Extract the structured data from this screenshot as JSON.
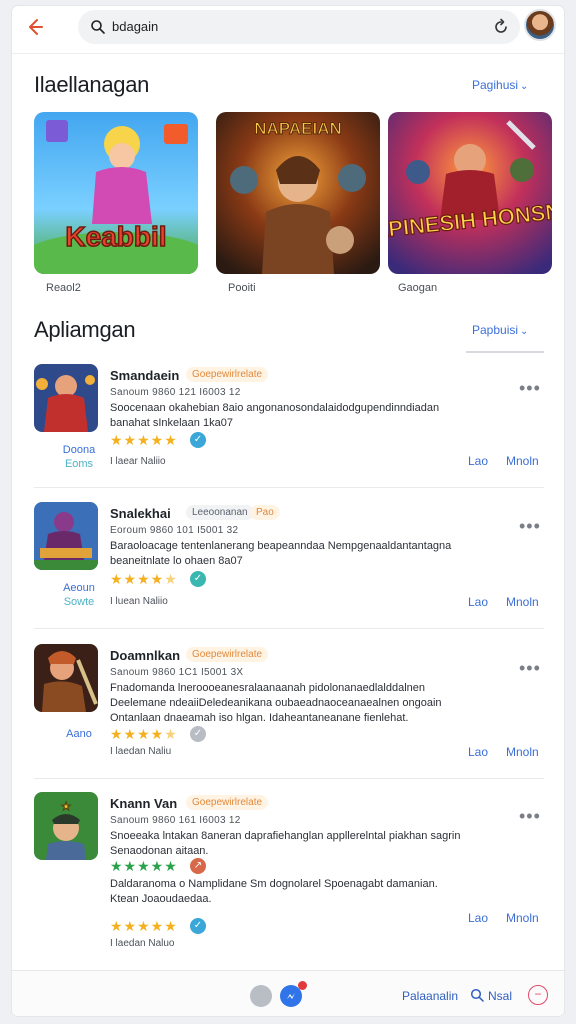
{
  "topbar": {
    "back_icon": "arrow-left-icon",
    "search_value": "bdagain",
    "search_icon": "search-icon",
    "refresh_icon": "refresh-icon",
    "avatar_icon": "user-avatar"
  },
  "featured": {
    "title": "Ilaellanagan",
    "see_all": "Pagihusi",
    "items": [
      {
        "label": "Reaol2",
        "art_text": "Keabbil"
      },
      {
        "label": "Pooiti",
        "art_text": "NAPAEIAN"
      },
      {
        "label": "Gaogan",
        "art_text": "HAPINESIH HONSNIS"
      }
    ]
  },
  "apps": {
    "title": "Apliamgan",
    "see_all": "Papbuisi",
    "items": [
      {
        "name": "Smandaein",
        "badge": "Goepewirlrelate",
        "meta": "Sanoum 9860 121 I6003 12",
        "desc_lines": [
          "Soocenaan okahebian 8aio angonanosondalaidodgupendinndiadan",
          "banahat sInkelaan 1ka07"
        ],
        "rating": 5,
        "rating_badge": "✓",
        "sub": "I laear Naliio",
        "side1": "Doona",
        "side2": "Eoms",
        "act1": "Lao",
        "act2": "Mnoln"
      },
      {
        "name": "Snalekhai",
        "badge": "Leeoonanan",
        "badge2": "Pao",
        "meta": "Eoroum 9860 101 I5001 32",
        "desc_lines": [
          "Baraoloacage tentenlanerang beapeanndaa Nempgenaaldantantagna",
          "beaneitnlate lo ohaen 8a07"
        ],
        "rating": 4,
        "rating_badge": "✓",
        "sub": "I luean Naliio",
        "side1": "Aeoun",
        "side2": "Sowte",
        "act1": "Lao",
        "act2": "Mnoln"
      },
      {
        "name": "Doamnlkan",
        "badge": "Goepewirlrelate",
        "meta": "Sanoum 9860 1C1 I5001 3X",
        "desc_lines": [
          "Fnadomanda lneroooeanesralaanaanah pidolonanaedlalddalnen",
          "Deelemane ndeaiiDeledeanikana oubaeadnaoceanaealnen ongoain",
          "Ontanlaan dnaeamah iso hlgan. Idaheantaneanane fienlehat."
        ],
        "rating": 4,
        "rating_badge": "✓",
        "sub": "I laedan Naliu",
        "side1": "Aano",
        "side2": "",
        "act1": "Lao",
        "act2": "Mnoln"
      },
      {
        "name": "Knann Van",
        "badge": "Goepewirlrelate",
        "meta": "Sanoum 9860 161 I6003 12",
        "desc_lines": [
          "Snoeeaka lntakan 8aneran daprafiehanglan appllerelntal piakhan sagrin",
          "Senaodonan aitaan."
        ],
        "rating": 5,
        "rating_badge": "↗",
        "green_stars": true,
        "extra_lines": [
          "Daldaranoma o Namplidane Sm dognolarel Spoenagabt damanian.",
          "Ktean Joaoudaedaa."
        ],
        "rating2": 5,
        "rating2_badge": "✓",
        "sub": "I laedan Naluo",
        "side1": "",
        "side2": "",
        "act1": "Lao",
        "act2": "Mnoln"
      }
    ]
  },
  "bottombar": {
    "label1": "Palaanalin",
    "label2": "Nsal",
    "search_icon": "search-icon",
    "gray_icon": "circle-icon",
    "blue_icon": "messenger-icon",
    "circle_icon": "minus-circle-icon",
    "colors": {
      "gray": "#b9bdc4",
      "blue": "#2f74e8",
      "notify": "#e23a3a"
    }
  },
  "colors": {
    "accent": "#3b6fd8",
    "star": "#f4b01f",
    "back": "#e0502f"
  }
}
